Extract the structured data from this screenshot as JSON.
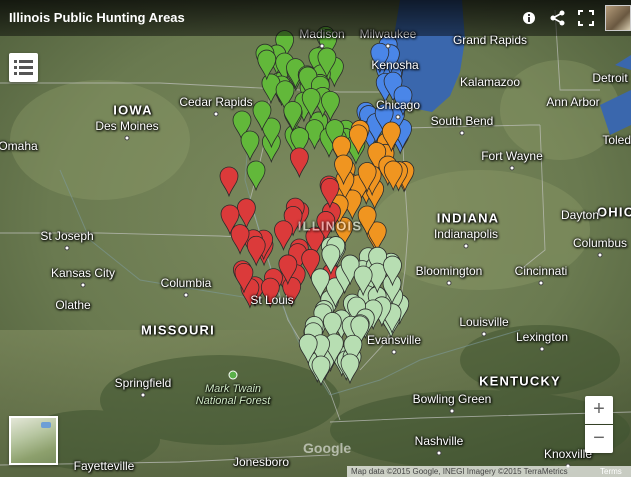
{
  "header": {
    "title": "Illinois Public Hunting Areas",
    "icons": [
      "info-icon",
      "share-icon",
      "fullscreen-icon"
    ]
  },
  "controls": {
    "legend_icon": "list-icon",
    "zoom_in": "+",
    "zoom_out": "−"
  },
  "attribution": {
    "logo": "Google",
    "text": "Map data ©2015 Google, INEGI Imagery ©2015 TerraMetrics",
    "terms": "Terms"
  },
  "colors": {
    "green": "#62b83a",
    "blue": "#4a86e8",
    "orange": "#f09520",
    "red": "#db3a3a",
    "lightgreen": "#b7deb2",
    "lake": "#3f6fb5"
  },
  "places": {
    "states": [
      "IOWA",
      "MISSOURI",
      "INDIANA",
      "KENTUCKY",
      "OHIO",
      "ILLINOIS"
    ],
    "cities": [
      "Madison",
      "Milwaukee",
      "Kenosha",
      "Chicago",
      "Kalamazoo",
      "Detroit",
      "Ann Arbor",
      "South Bend",
      "Toledo",
      "Cedar Rapids",
      "Des Moines",
      "Omaha",
      "Fort Wayne",
      "St Joseph",
      "Kansas City",
      "Olathe",
      "Columbia",
      "St Louis",
      "Indianapolis",
      "Columbus",
      "Bloomington",
      "Cincinnati",
      "Louisville",
      "Lexington",
      "Evansville",
      "Springfield",
      "Bowling Green",
      "Nashville",
      "Knoxville",
      "Jonesboro",
      "Fayetteville",
      "Grand Rapids",
      "Dayton"
    ],
    "parks": [
      "Mark Twain",
      "National Forest"
    ]
  }
}
